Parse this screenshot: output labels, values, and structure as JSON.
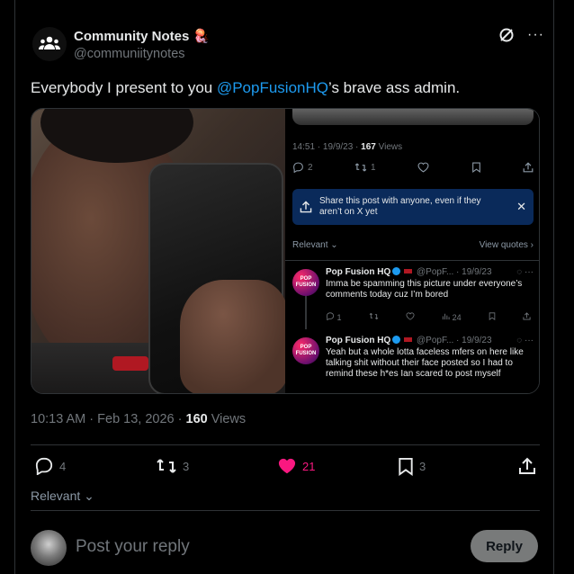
{
  "author": {
    "name": "Community Notes",
    "handle": "@communiitynotes",
    "badge_icon": "jellyfish-emoji-icon"
  },
  "post": {
    "text_prefix": "Everybody I present to you ",
    "mention": "@PopFusionHQ",
    "text_suffix": "’s brave ass admin."
  },
  "embedded": {
    "meta_time": "14:51 · 19/9/23 · ",
    "meta_views_count": "167",
    "meta_views_label": " Views",
    "actions": {
      "replies": "2",
      "reposts": "1"
    },
    "share_prompt": "Share this post with anyone, even if they aren’t on X yet",
    "relevant": "Relevant",
    "view_quotes": "View quotes",
    "replies": [
      {
        "name": "Pop Fusion HQ",
        "handle_date": "@PopF... · 19/9/23",
        "avatar_text": "POP FUSION",
        "text": "Imma be spamming this picture under everyone’s comments today cuz I’m bored",
        "replies": "1",
        "views": "24"
      },
      {
        "name": "Pop Fusion HQ",
        "handle_date": "@PopF... · 19/9/23",
        "avatar_text": "POP FUSION",
        "text": "Yeah but a whole lotta faceless mfers on here like talking shit without their face posted so I had to remind these h*es Ian scared to post myself"
      }
    ]
  },
  "timestamp": {
    "time": "10:13 AM · Feb 13, 2026 · ",
    "views_count": "160",
    "views_label": " Views"
  },
  "actions": {
    "replies": "4",
    "reposts": "3",
    "likes": "21",
    "bookmarks": "3"
  },
  "colors": {
    "accent": "#1d9bf0",
    "like": "#f91880",
    "background": "#000000"
  },
  "sort": {
    "label": "Relevant"
  },
  "composer": {
    "placeholder": "Post your reply",
    "button": "Reply"
  }
}
